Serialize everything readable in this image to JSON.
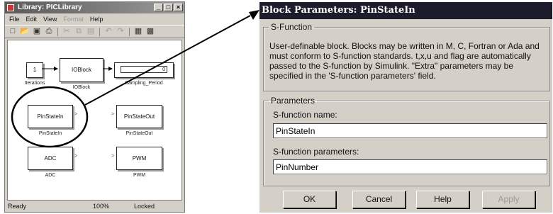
{
  "library_window": {
    "title": "Library: PICLibrary",
    "menu": [
      {
        "label": "File",
        "enabled": true
      },
      {
        "label": "Edit",
        "enabled": true
      },
      {
        "label": "View",
        "enabled": true
      },
      {
        "label": "Format",
        "enabled": false
      },
      {
        "label": "Help",
        "enabled": true
      }
    ],
    "toolbar_icons": [
      "new-icon",
      "open-icon",
      "save-icon",
      "print-icon",
      "cut-icon",
      "copy-icon",
      "paste-icon",
      "undo-icon",
      "redo-icon",
      "library-browser-icon",
      "model-browser-icon"
    ],
    "status": {
      "state": "Ready",
      "zoom": "100%",
      "lock": "Locked"
    }
  },
  "blocks": {
    "iterations": {
      "value": "1",
      "label": "Iterations"
    },
    "ioblock": {
      "text": "IOBlock",
      "label": "IOBlock"
    },
    "sampling": {
      "value": "0",
      "label": "Sampling_Period"
    },
    "pinstatein": {
      "text": "PinStateIn",
      "label": "PinStateIn"
    },
    "pinstateout": {
      "text": "PinStateOut",
      "label": "PinStateOut"
    },
    "adc": {
      "text": "ADC",
      "label": "ADC"
    },
    "pwm": {
      "text": "PWM",
      "label": "PWM"
    }
  },
  "dialog": {
    "title": "Block Parameters: PinStateIn",
    "sfunction_group": "S-Function",
    "description_lines": [
      "User-definable block.  Blocks may be written in M, C, Fortran or Ada and",
      "must  conform to S-function standards.  t,x,u and flag are automatically",
      "passed to the S-function by Simulink.  \"Extra\" parameters may be",
      "specified in the 'S-function parameters' field."
    ],
    "params_group": "Parameters",
    "name_label": "S-function name:",
    "name_value": "PinStateIn",
    "params_label": "S-function parameters:",
    "params_value": "PinNumber",
    "buttons": {
      "ok": "OK",
      "cancel": "Cancel",
      "help": "Help",
      "apply": "Apply"
    },
    "apply_enabled": false
  }
}
